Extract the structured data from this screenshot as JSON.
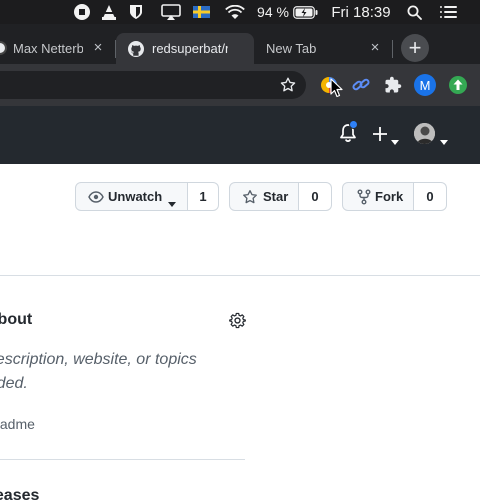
{
  "menubar": {
    "battery_percent": "94 %",
    "clock": "Fri 18:39"
  },
  "tabs": [
    {
      "title": "Max Netterberg",
      "active": false
    },
    {
      "title": "redsuperbat/repo",
      "active": true
    },
    {
      "title": "New Tab",
      "active": false
    }
  ],
  "toolbar": {
    "profile_initial": "M"
  },
  "repo_actions": {
    "watch": {
      "label": "Unwatch",
      "count": "1"
    },
    "star": {
      "label": "Star",
      "count": "0"
    },
    "fork": {
      "label": "Fork",
      "count": "0"
    }
  },
  "about": {
    "title": "About",
    "description": "No description, website, or topics provided.",
    "readme": "Readme"
  },
  "releases": {
    "title": "Releases"
  },
  "colors": {
    "menubar_bg": "#1c1c1e",
    "chrome_dark": "#202124",
    "chrome_toolbar": "#35363a",
    "github_header": "#24292f",
    "notification_dot": "#2f81f7",
    "profile_avatar": "#1a73e8",
    "extension_green": "#34a853"
  }
}
